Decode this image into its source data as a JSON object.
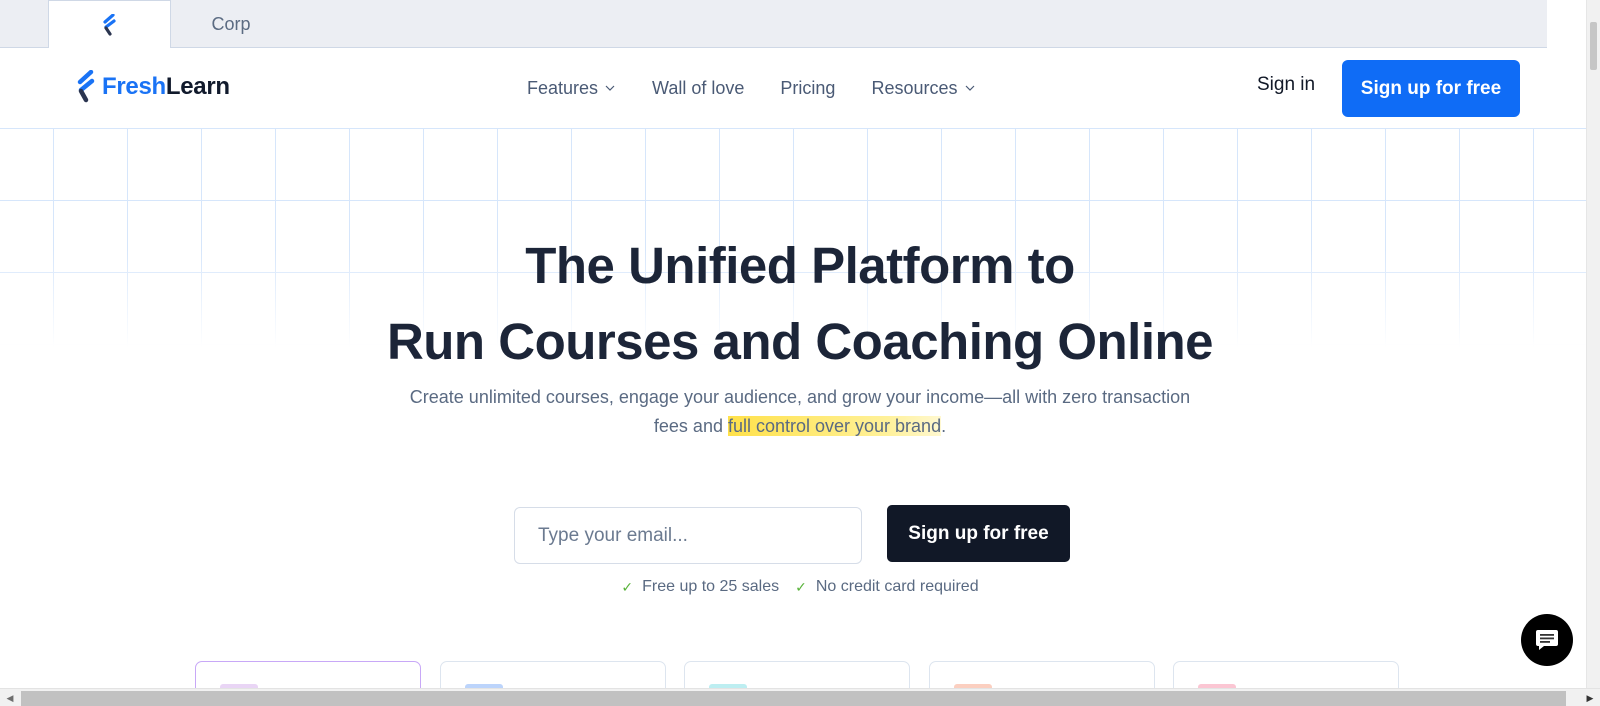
{
  "browser": {
    "tabs": [
      {
        "label": "",
        "icon": "freshlearn-favicon",
        "active": true
      },
      {
        "label": "Corp",
        "active": false
      }
    ]
  },
  "header": {
    "logo": {
      "part1": "Fresh",
      "part2": "Learn",
      "icon": "freshlearn-logo-icon"
    },
    "nav": [
      {
        "label": "Features",
        "has_dropdown": true
      },
      {
        "label": "Wall of love",
        "has_dropdown": false
      },
      {
        "label": "Pricing",
        "has_dropdown": false
      },
      {
        "label": "Resources",
        "has_dropdown": true
      }
    ],
    "signin_label": "Sign in",
    "signup_label": "Sign up for free"
  },
  "hero": {
    "title_line1": "The Unified Platform to",
    "title_line2": "Run Courses and Coaching Online",
    "subtitle_line1": "Create unlimited courses, engage your audience, and grow your income—all with zero transaction",
    "subtitle_line2_prefix": "fees and ",
    "subtitle_highlight": "full control over your brand",
    "subtitle_suffix": ".",
    "email_placeholder": "Type your email...",
    "email_value": "",
    "signup_label": "Sign up for free",
    "perks": [
      "Free up to 25 sales",
      "No credit card required"
    ]
  },
  "cards": [
    {
      "accent": "#e9d5f5"
    },
    {
      "accent": "#bcd4fb"
    },
    {
      "accent": "#bdeef1"
    },
    {
      "accent": "#fbcfc0"
    },
    {
      "accent": "#fbc6d3"
    }
  ],
  "colors": {
    "brand_blue": "#0f6cf6",
    "dark": "#111827",
    "highlight": "#ffe14a",
    "check_green": "#58b33a"
  }
}
